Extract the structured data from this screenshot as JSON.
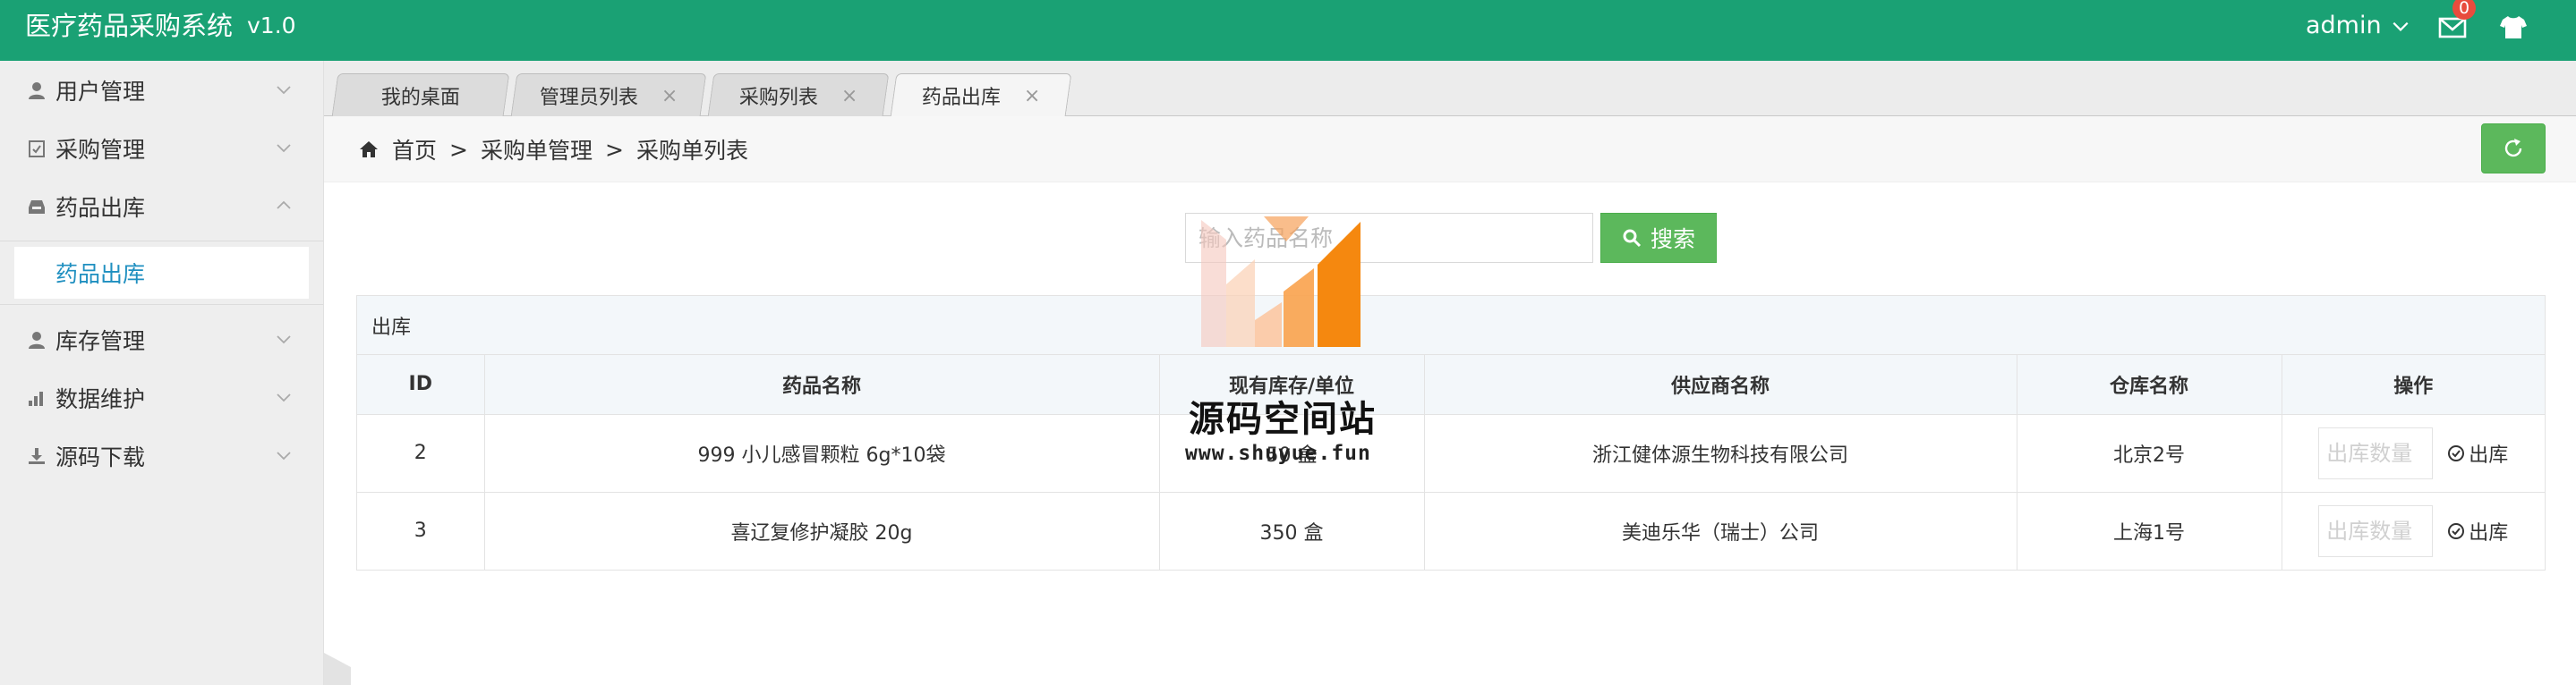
{
  "header": {
    "title": "医疗药品采购系统",
    "version": "v1.0",
    "user": "admin",
    "mail_count": "0",
    "icons": [
      "chevron-down-icon",
      "mail-icon",
      "shirt-icon"
    ]
  },
  "sidebar": {
    "items": [
      {
        "label": "用户管理",
        "icon": "user-icon"
      },
      {
        "label": "采购管理",
        "icon": "clipboard-icon"
      },
      {
        "label": "药品出库",
        "icon": "inbox-icon",
        "expanded": true
      },
      {
        "label": "库存管理",
        "icon": "user-icon"
      },
      {
        "label": "数据维护",
        "icon": "bar-chart-icon"
      },
      {
        "label": "源码下载",
        "icon": "download-icon"
      }
    ],
    "active_sub": "药品出库"
  },
  "tabs": [
    {
      "label": "我的桌面"
    },
    {
      "label": "管理员列表"
    },
    {
      "label": "采购列表"
    },
    {
      "label": "药品出库",
      "active": true
    }
  ],
  "breadcrumb": {
    "home": "首页",
    "sep": ">",
    "level2": "采购单管理",
    "level3": "采购单列表"
  },
  "search": {
    "placeholder": "输入药品名称",
    "button": "搜索"
  },
  "panel": {
    "title": "出库"
  },
  "table": {
    "headers": [
      "ID",
      "药品名称",
      "现有库存/单位",
      "供应商名称",
      "仓库名称",
      "操作"
    ],
    "rows": [
      {
        "id": "2",
        "name": "999 小儿感冒颗粒 6g*10袋",
        "stock": "50 盒",
        "supplier": "浙江健体源生物科技有限公司",
        "warehouse": "北京2号"
      },
      {
        "id": "3",
        "name": "喜辽复修护凝胶 20g",
        "stock": "350 盒",
        "supplier": "美迪乐华（瑞士）公司",
        "warehouse": "上海1号"
      }
    ],
    "qty_placeholder": "出库数量",
    "action": "出库"
  },
  "watermark": {
    "title": "源码空间站",
    "url": "www.shuyue.fun"
  },
  "colors": {
    "header": "#1aa174",
    "button": "#5cb85c",
    "link": "#1f8fc0",
    "badge": "#e84c3d"
  }
}
